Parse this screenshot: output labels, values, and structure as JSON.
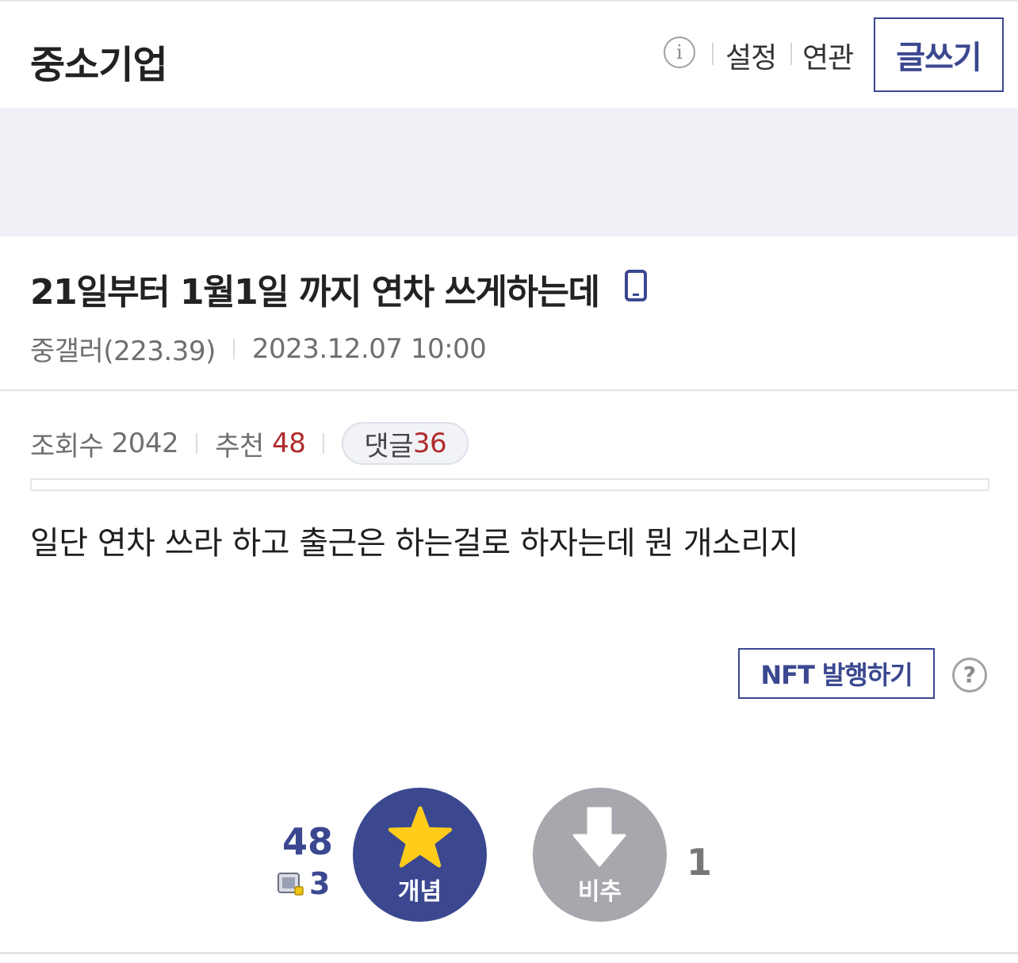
{
  "header": {
    "gallery_name": "중소기업",
    "settings_label": "설정",
    "related_label": "연관",
    "write_label": "글쓰기"
  },
  "post": {
    "title": "21일부터 1월1일 까지 연차 쓰게하는데",
    "author": "중갤러(223.39)",
    "datetime": "2023.12.07 10:00",
    "views_label": "조회수",
    "views": "2042",
    "recommend_label": "추천",
    "recommend": "48",
    "comments_label": "댓글",
    "comments": "36",
    "body": "일단 연차 쓰라 하고 출근은 하는걸로 하자는데 뭔 개소리지"
  },
  "nft": {
    "label": "NFT 발행하기",
    "help": "?"
  },
  "vote": {
    "up_count": "48",
    "fixed_count": "3",
    "up_label": "개념",
    "down_label": "비추",
    "down_count": "1"
  },
  "colors": {
    "accent": "#3b4890",
    "red": "#b22b2b",
    "downvote": "#a7a7ad"
  },
  "icons": [
    "info-icon",
    "mobile-icon",
    "help-icon",
    "star-icon",
    "down-arrow-icon",
    "fix-icon"
  ]
}
